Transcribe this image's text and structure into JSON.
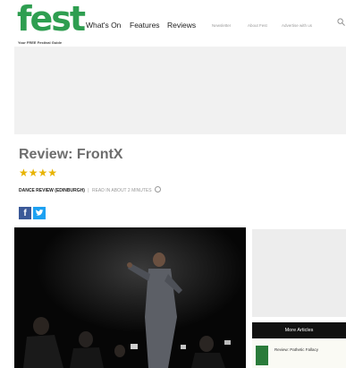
{
  "header": {
    "logo_text": "fest",
    "logo_tagline": "Your FREE Festival Guide",
    "nav_main": [
      "What's On",
      "Features",
      "Reviews"
    ],
    "nav_secondary": [
      "Newsletter",
      "About Fest",
      "Advertise with us"
    ],
    "search_icon": "search-icon"
  },
  "article": {
    "title": "Review: FrontX",
    "rating_stars": "★★★★",
    "rating_value": 4,
    "category": "DANCE REVIEW (EDINBURGH)",
    "separator": "|",
    "read_time": "READ IN ABOUT 2 MINUTES"
  },
  "share": {
    "facebook": "f",
    "twitter": "🐦"
  },
  "sidebar": {
    "more_articles_label": "More Articles",
    "articles": [
      {
        "title": "Review: Pathetic Fallacy"
      }
    ]
  },
  "colors": {
    "brand": "#2e9e50",
    "star": "#e7b300",
    "facebook": "#3b5998",
    "twitter": "#1da1f2"
  }
}
